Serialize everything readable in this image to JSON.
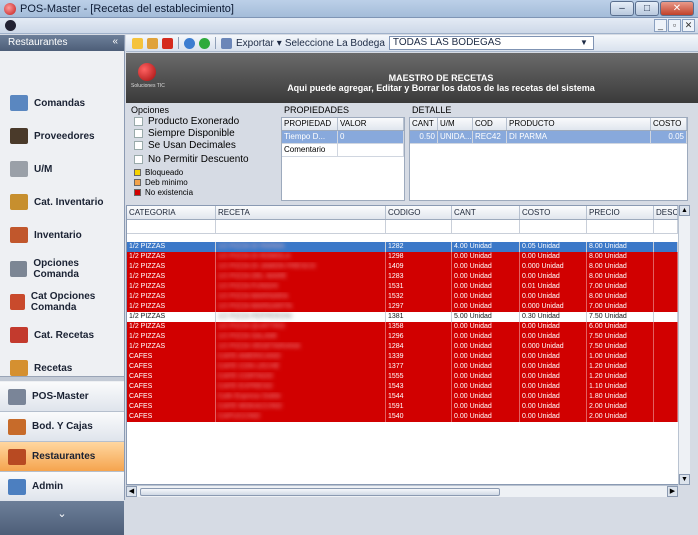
{
  "window": {
    "title": "POS-Master - [Recetas del establecimiento]"
  },
  "sidebar": {
    "header": "Restaurantes",
    "collapse_glyph": "«",
    "items": [
      {
        "label": "Comandas",
        "icon": "plates-icon",
        "color": "#5a87c0"
      },
      {
        "label": "Proveedores",
        "icon": "truck-icon",
        "color": "#4a3a2a"
      },
      {
        "label": "U/M",
        "icon": "scale-icon",
        "color": "#9aa0a8"
      },
      {
        "label": "Cat. Inventario",
        "icon": "cake-icon",
        "color": "#c78f2e"
      },
      {
        "label": "Inventario",
        "icon": "books-icon",
        "color": "#c1572c"
      },
      {
        "label": "Opciones Comanda",
        "icon": "printer-icon",
        "color": "#7c8694"
      },
      {
        "label": "Cat Opciones Comanda",
        "icon": "register-icon",
        "color": "#c94a2c"
      },
      {
        "label": "Cat. Recetas",
        "icon": "recipes-icon",
        "color": "#c33a2d"
      },
      {
        "label": "Recetas",
        "icon": "recipe-book-icon",
        "color": "#d59030"
      }
    ],
    "modules": [
      {
        "label": "POS-Master",
        "icon": "pos-icon",
        "color": "#7a8598"
      },
      {
        "label": "Bod. Y Cajas",
        "icon": "boxes-icon",
        "color": "#c76b2a"
      },
      {
        "label": "Restaurantes",
        "icon": "restaurant-icon",
        "color": "#b84a22"
      },
      {
        "label": "Admin",
        "icon": "chart-icon",
        "color": "#4c7fc0"
      }
    ],
    "footer_glyph": "⌄"
  },
  "toolbar": {
    "export_label": "Exportar",
    "select_label": "Seleccione La Bodega",
    "bodega_value": "TODAS LAS BODEGAS"
  },
  "banner": {
    "logo_text": "Soluciones TIC",
    "title": "MAESTRO DE RECETAS",
    "subtitle": "Aqui puede agregar, Editar y Borrar los datos de las recetas del sistema"
  },
  "opciones": {
    "title": "Opciones",
    "checks": [
      "Producto Exonerado",
      "Siempre Disponible",
      "Se Usan Decimales",
      "No Permitir Descuento"
    ],
    "legend": [
      {
        "label": "Bloqueado",
        "color": "#f6d200"
      },
      {
        "label": "Deb minimo",
        "color": "#f2a24a"
      },
      {
        "label": "No existencia",
        "color": "#d10000"
      }
    ]
  },
  "propiedades": {
    "title": "PROPIEDADES",
    "columns": [
      "PROPIEDAD",
      "VALOR"
    ],
    "rows": [
      [
        "Tiempo D...",
        "0"
      ],
      [
        "Comentario",
        ""
      ]
    ]
  },
  "detalle": {
    "title": "DETALLE",
    "columns": [
      "CANT",
      "U/M",
      "COD",
      "PRODUCTO",
      "COSTO"
    ],
    "rows": [
      [
        "0.50",
        "UNIDA...",
        "REC42",
        "DI PARMA",
        "0.05"
      ]
    ]
  },
  "grid": {
    "columns": [
      "CATEGORIA",
      "RECETA",
      "CODIGO",
      "CANT",
      "COSTO",
      "PRECIO",
      "DESC"
    ],
    "rows": [
      {
        "cat": "1/2 PIZZAS",
        "receta": "1/2 PIZZA DI PARMA",
        "codigo": "1282",
        "cant": "4.00 Unidad",
        "costo": "0.05 Unidad",
        "precio": "8.00 Unidad",
        "style": "sel"
      },
      {
        "cat": "1/2 PIZZAS",
        "receta": "1/2 PIZZA DI ROMOLA",
        "codigo": "1298",
        "cant": "0.00 Unidad",
        "costo": "0.00 Unidad",
        "precio": "8.00 Unidad",
        "style": "red"
      },
      {
        "cat": "1/2 PIZZAS",
        "receta": "1/2 PIZZA DI JAMON FRESCO",
        "codigo": "1409",
        "cant": "0.00 Unidad",
        "costo": "0.000 Unidad",
        "precio": "8.00 Unidad",
        "style": "red"
      },
      {
        "cat": "1/2 PIZZAS",
        "receta": "1/2 PIZZA DEL MARE",
        "codigo": "1283",
        "cant": "0.00 Unidad",
        "costo": "0.00 Unidad",
        "precio": "8.00 Unidad",
        "style": "red"
      },
      {
        "cat": "1/2 PIZZAS",
        "receta": "1/2 PIZZA FUNGHI",
        "codigo": "1531",
        "cant": "0.00 Unidad",
        "costo": "0.01 Unidad",
        "precio": "7.00 Unidad",
        "style": "red"
      },
      {
        "cat": "1/2 PIZZAS",
        "receta": "1/2 PIZZA MARINARA",
        "codigo": "1532",
        "cant": "0.00 Unidad",
        "costo": "0.00 Unidad",
        "precio": "8.00 Unidad",
        "style": "red"
      },
      {
        "cat": "1/2 PIZZAS",
        "receta": "1/2 PIZZA MARGARITA",
        "codigo": "1297",
        "cant": "0.00 Unidad",
        "costo": "0.000 Unidad",
        "precio": "7.00 Unidad",
        "style": "red"
      },
      {
        "cat": "1/2 PIZZAS",
        "receta": "1/2 PIZZA PEPPERONI",
        "codigo": "1381",
        "cant": "5.00 Unidad",
        "costo": "0.30 Unidad",
        "precio": "7.50 Unidad",
        "style": "white"
      },
      {
        "cat": "1/2 PIZZAS",
        "receta": "1/2 PIZZA QUATTRO",
        "codigo": "1358",
        "cant": "0.00 Unidad",
        "costo": "0.00 Unidad",
        "precio": "6.00 Unidad",
        "style": "red"
      },
      {
        "cat": "1/2 PIZZAS",
        "receta": "1/2 PIZZA SALAMI",
        "codigo": "1296",
        "cant": "0.00 Unidad",
        "costo": "0.00 Unidad",
        "precio": "7.50 Unidad",
        "style": "red"
      },
      {
        "cat": "1/2 PIZZAS",
        "receta": "1/2 PIZZA VEGETARIANA",
        "codigo": "1284",
        "cant": "0.00 Unidad",
        "costo": "0.000 Unidad",
        "precio": "7.50 Unidad",
        "style": "red"
      },
      {
        "cat": "CAFES",
        "receta": "CAFE AMERICANO",
        "codigo": "1339",
        "cant": "0.00 Unidad",
        "costo": "0.00 Unidad",
        "precio": "1.00 Unidad",
        "style": "red"
      },
      {
        "cat": "CAFES",
        "receta": "CAFE CON LECHE",
        "codigo": "1377",
        "cant": "0.00 Unidad",
        "costo": "0.00 Unidad",
        "precio": "1.20 Unidad",
        "style": "red"
      },
      {
        "cat": "CAFES",
        "receta": "CAFE CORTADO",
        "codigo": "1555",
        "cant": "0.00 Unidad",
        "costo": "0.00 Unidad",
        "precio": "1.20 Unidad",
        "style": "red"
      },
      {
        "cat": "CAFES",
        "receta": "CAFE EXPRESO",
        "codigo": "1543",
        "cant": "0.00 Unidad",
        "costo": "0.00 Unidad",
        "precio": "1.10 Unidad",
        "style": "red"
      },
      {
        "cat": "CAFES",
        "receta": "Cafe Expreso Doble",
        "codigo": "1544",
        "cant": "0.00 Unidad",
        "costo": "0.00 Unidad",
        "precio": "1.80 Unidad",
        "style": "red"
      },
      {
        "cat": "CAFES",
        "receta": "CAFE MOKACCINO",
        "codigo": "1591",
        "cant": "0.00 Unidad",
        "costo": "0.00 Unidad",
        "precio": "2.00 Unidad",
        "style": "red"
      },
      {
        "cat": "CAFES",
        "receta": "CAPUCCINO",
        "codigo": "1540",
        "cant": "0.00 Unidad",
        "costo": "0.00 Unidad",
        "precio": "2.00 Unidad",
        "style": "red"
      }
    ]
  }
}
